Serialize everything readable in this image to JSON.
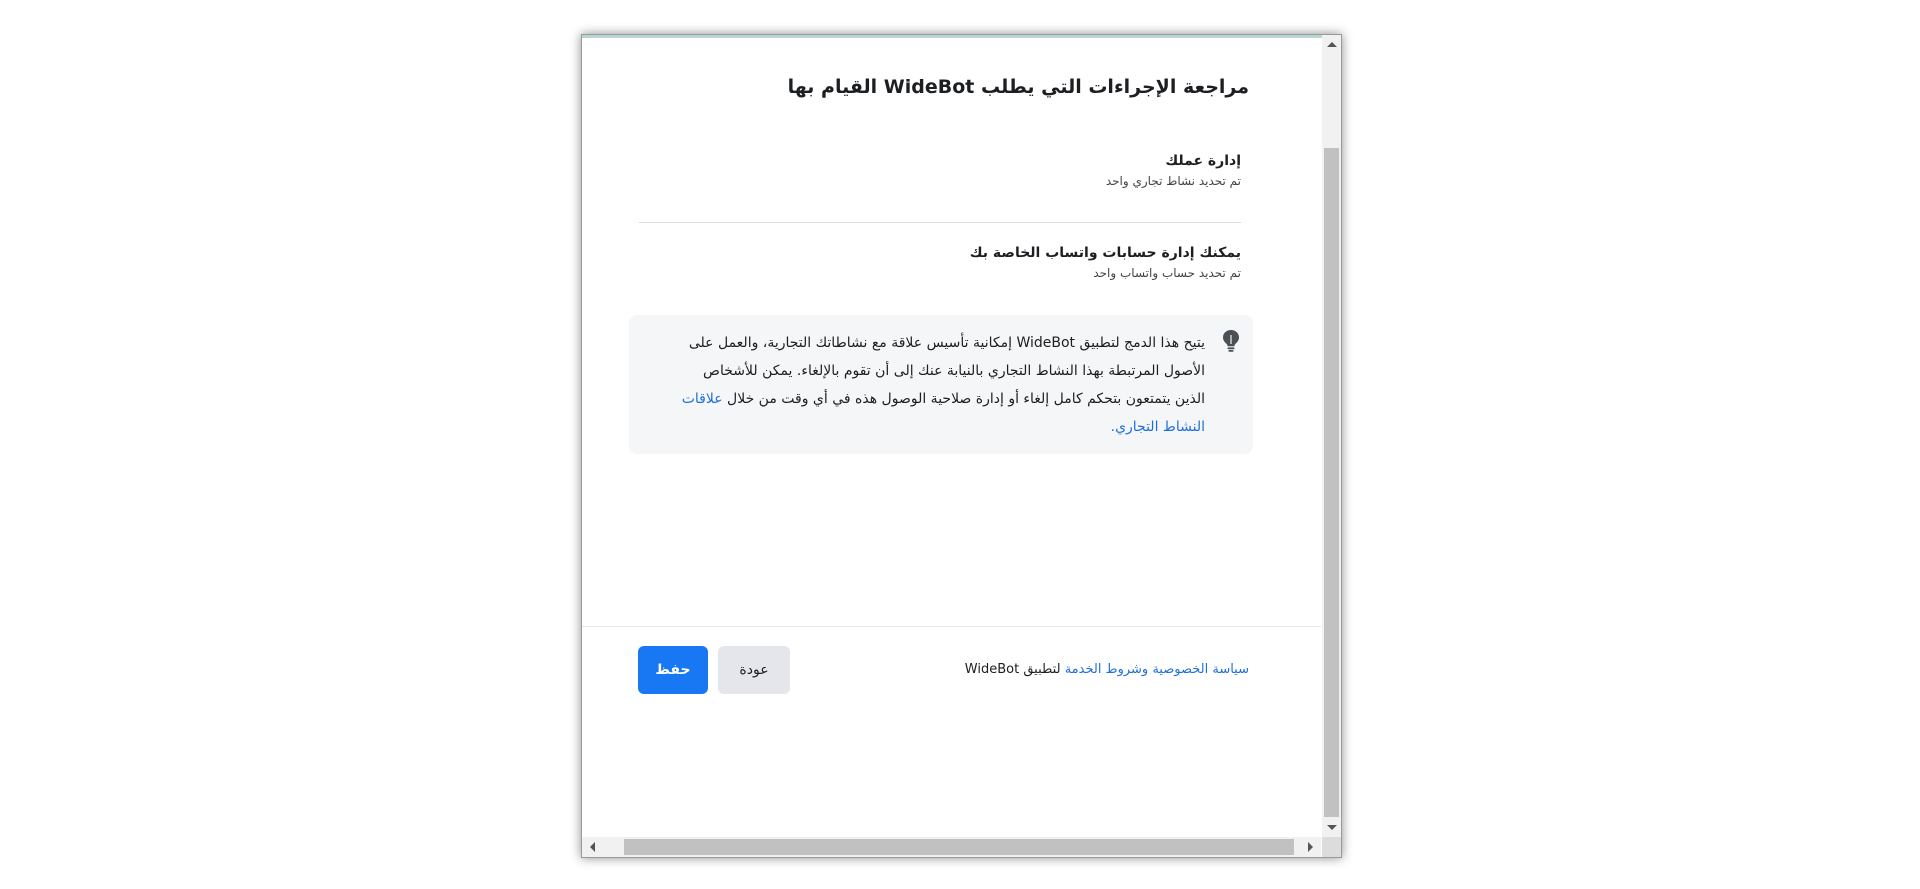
{
  "dialog": {
    "title": "مراجعة الإجراءات التي يطلب WideBot القيام بها",
    "sections": [
      {
        "title": "إدارة عملك",
        "subtitle": "تم تحديد نشاط تجاري واحد"
      },
      {
        "title": "يمكنك إدارة حسابات واتساب الخاصة بك",
        "subtitle": "تم تحديد حساب واتساب واحد"
      }
    ],
    "info": {
      "icon": "lightbulb-icon",
      "text": "يتيح هذا الدمج لتطبيق WideBot إمكانية تأسيس علاقة مع نشاطاتك التجارية، والعمل على الأصول المرتبطة بهذا النشاط التجاري بالنيابة عنك إلى أن تقوم بالإلغاء. يمكن للأشخاص الذين يتمتعون بتحكم كامل إلغاء أو إدارة صلاحية الوصول هذه في أي وقت من خلال ",
      "link_text": "علاقات النشاط التجاري",
      "text_end": "."
    },
    "footer": {
      "policy_link": "سياسة الخصوصية وشروط الخدمة",
      "policy_suffix": " لتطبيق WideBot",
      "back_label": "عودة",
      "save_label": "حفظ"
    }
  },
  "colors": {
    "primary": "#1877f2",
    "link": "#216fdb",
    "info_background": "#f5f6f7",
    "secondary_button": "#e4e6eb"
  }
}
